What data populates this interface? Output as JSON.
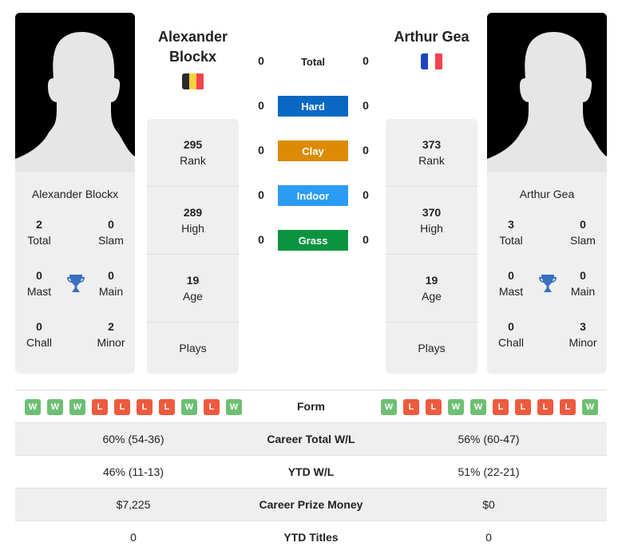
{
  "player1": {
    "name": "Alexander Blockx",
    "name_line1": "Alexander",
    "name_line2": "Blockx",
    "flag": {
      "country": "Belgium",
      "colors": [
        "#2b2b2b",
        "#fdd13a",
        "#f2444e"
      ]
    },
    "titles": {
      "total": {
        "value": "2",
        "label": "Total"
      },
      "slam": {
        "value": "0",
        "label": "Slam"
      },
      "mast": {
        "value": "0",
        "label": "Mast"
      },
      "main": {
        "value": "0",
        "label": "Main"
      },
      "chall": {
        "value": "0",
        "label": "Chall"
      },
      "minor": {
        "value": "2",
        "label": "Minor"
      }
    },
    "stats": {
      "rank": {
        "value": "295",
        "label": "Rank"
      },
      "high": {
        "value": "289",
        "label": "High"
      },
      "age": {
        "value": "19",
        "label": "Age"
      },
      "plays": {
        "value": "",
        "label": "Plays"
      }
    },
    "form": [
      "W",
      "W",
      "W",
      "L",
      "L",
      "L",
      "L",
      "W",
      "L",
      "W"
    ]
  },
  "player2": {
    "name": "Arthur Gea",
    "flag": {
      "country": "France",
      "colors": [
        "#1d43c1",
        "#ffffff",
        "#f2444e"
      ]
    },
    "titles": {
      "total": {
        "value": "3",
        "label": "Total"
      },
      "slam": {
        "value": "0",
        "label": "Slam"
      },
      "mast": {
        "value": "0",
        "label": "Mast"
      },
      "main": {
        "value": "0",
        "label": "Main"
      },
      "chall": {
        "value": "0",
        "label": "Chall"
      },
      "minor": {
        "value": "3",
        "label": "Minor"
      }
    },
    "stats": {
      "rank": {
        "value": "373",
        "label": "Rank"
      },
      "high": {
        "value": "370",
        "label": "High"
      },
      "age": {
        "value": "19",
        "label": "Age"
      },
      "plays": {
        "value": "",
        "label": "Plays"
      }
    },
    "form": [
      "W",
      "L",
      "L",
      "W",
      "W",
      "L",
      "L",
      "L",
      "L",
      "W"
    ]
  },
  "head_to_head": [
    {
      "label": "Total",
      "left": "0",
      "right": "0",
      "color": ""
    },
    {
      "label": "Hard",
      "left": "0",
      "right": "0",
      "color": "#0868c4"
    },
    {
      "label": "Clay",
      "left": "0",
      "right": "0",
      "color": "#dd8b05"
    },
    {
      "label": "Indoor",
      "left": "0",
      "right": "0",
      "color": "#2b9cf6"
    },
    {
      "label": "Grass",
      "left": "0",
      "right": "0",
      "color": "#0b9440"
    }
  ],
  "comparison": {
    "form_label": "Form",
    "rows": [
      {
        "label": "Career Total W/L",
        "left": "60% (54-36)",
        "right": "56% (60-47)"
      },
      {
        "label": "YTD W/L",
        "left": "46% (11-13)",
        "right": "51% (22-21)"
      },
      {
        "label": "Career Prize Money",
        "left": "$7,225",
        "right": "$0"
      },
      {
        "label": "YTD Titles",
        "left": "0",
        "right": "0"
      }
    ]
  },
  "colors": {
    "win": "#6dbf73",
    "loss": "#ee5a3e",
    "trophy": "#3b6fc2"
  }
}
